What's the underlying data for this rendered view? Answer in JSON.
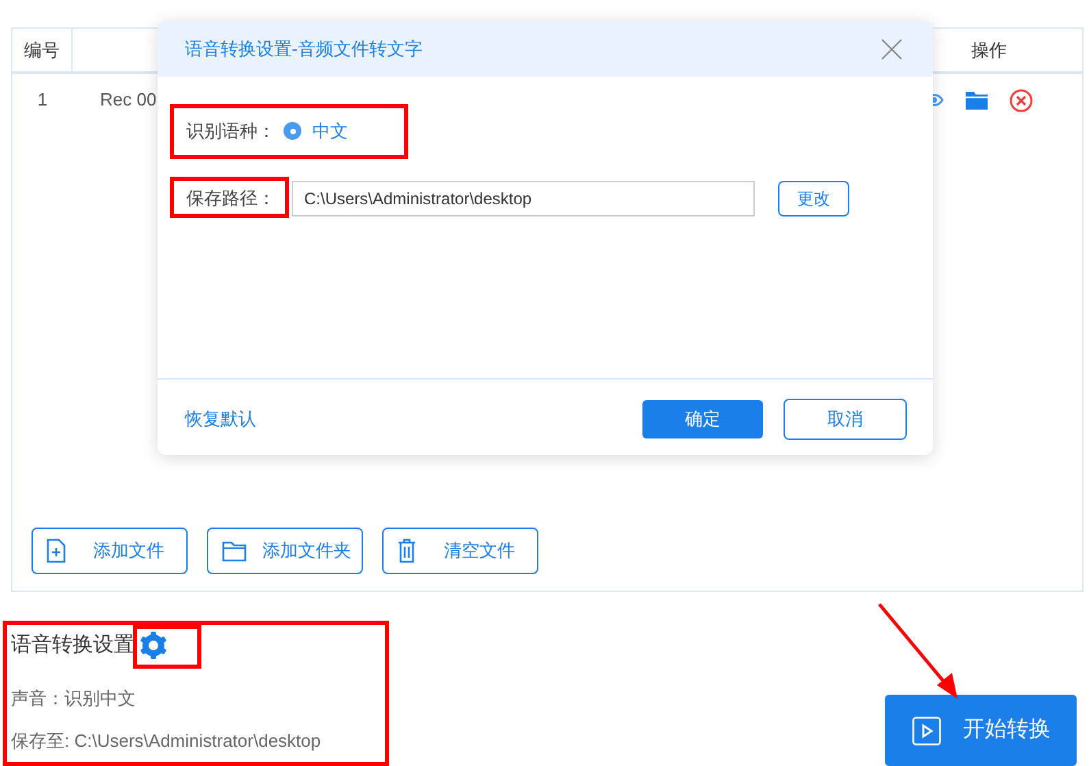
{
  "table": {
    "columns": [
      "编号",
      "操作"
    ],
    "rows": [
      {
        "number": "1",
        "name": "Rec 00"
      }
    ]
  },
  "toolbar_buttons": [
    {
      "kind": "file",
      "label": "添加文件"
    },
    {
      "kind": "folder",
      "label": "添加文件夹"
    },
    {
      "kind": "trash",
      "label": "清空文件"
    }
  ],
  "settings": {
    "title": "语音转换设置",
    "voice": "声音：识别中文",
    "save_to": "保存至: C:\\Users\\Administrator\\desktop"
  },
  "start_button": "开始转换",
  "dialog": {
    "title": "语音转换设置-音频文件转文字",
    "language_label": "识别语种：",
    "language_option": {
      "label": "中文",
      "selected": true
    },
    "path_label": "保存路径：",
    "path_value": "C:\\Users\\Administrator\\desktop",
    "change_button": "更改",
    "reset_link": "恢复默认",
    "ok_button": "确定",
    "cancel_button": "取消"
  }
}
